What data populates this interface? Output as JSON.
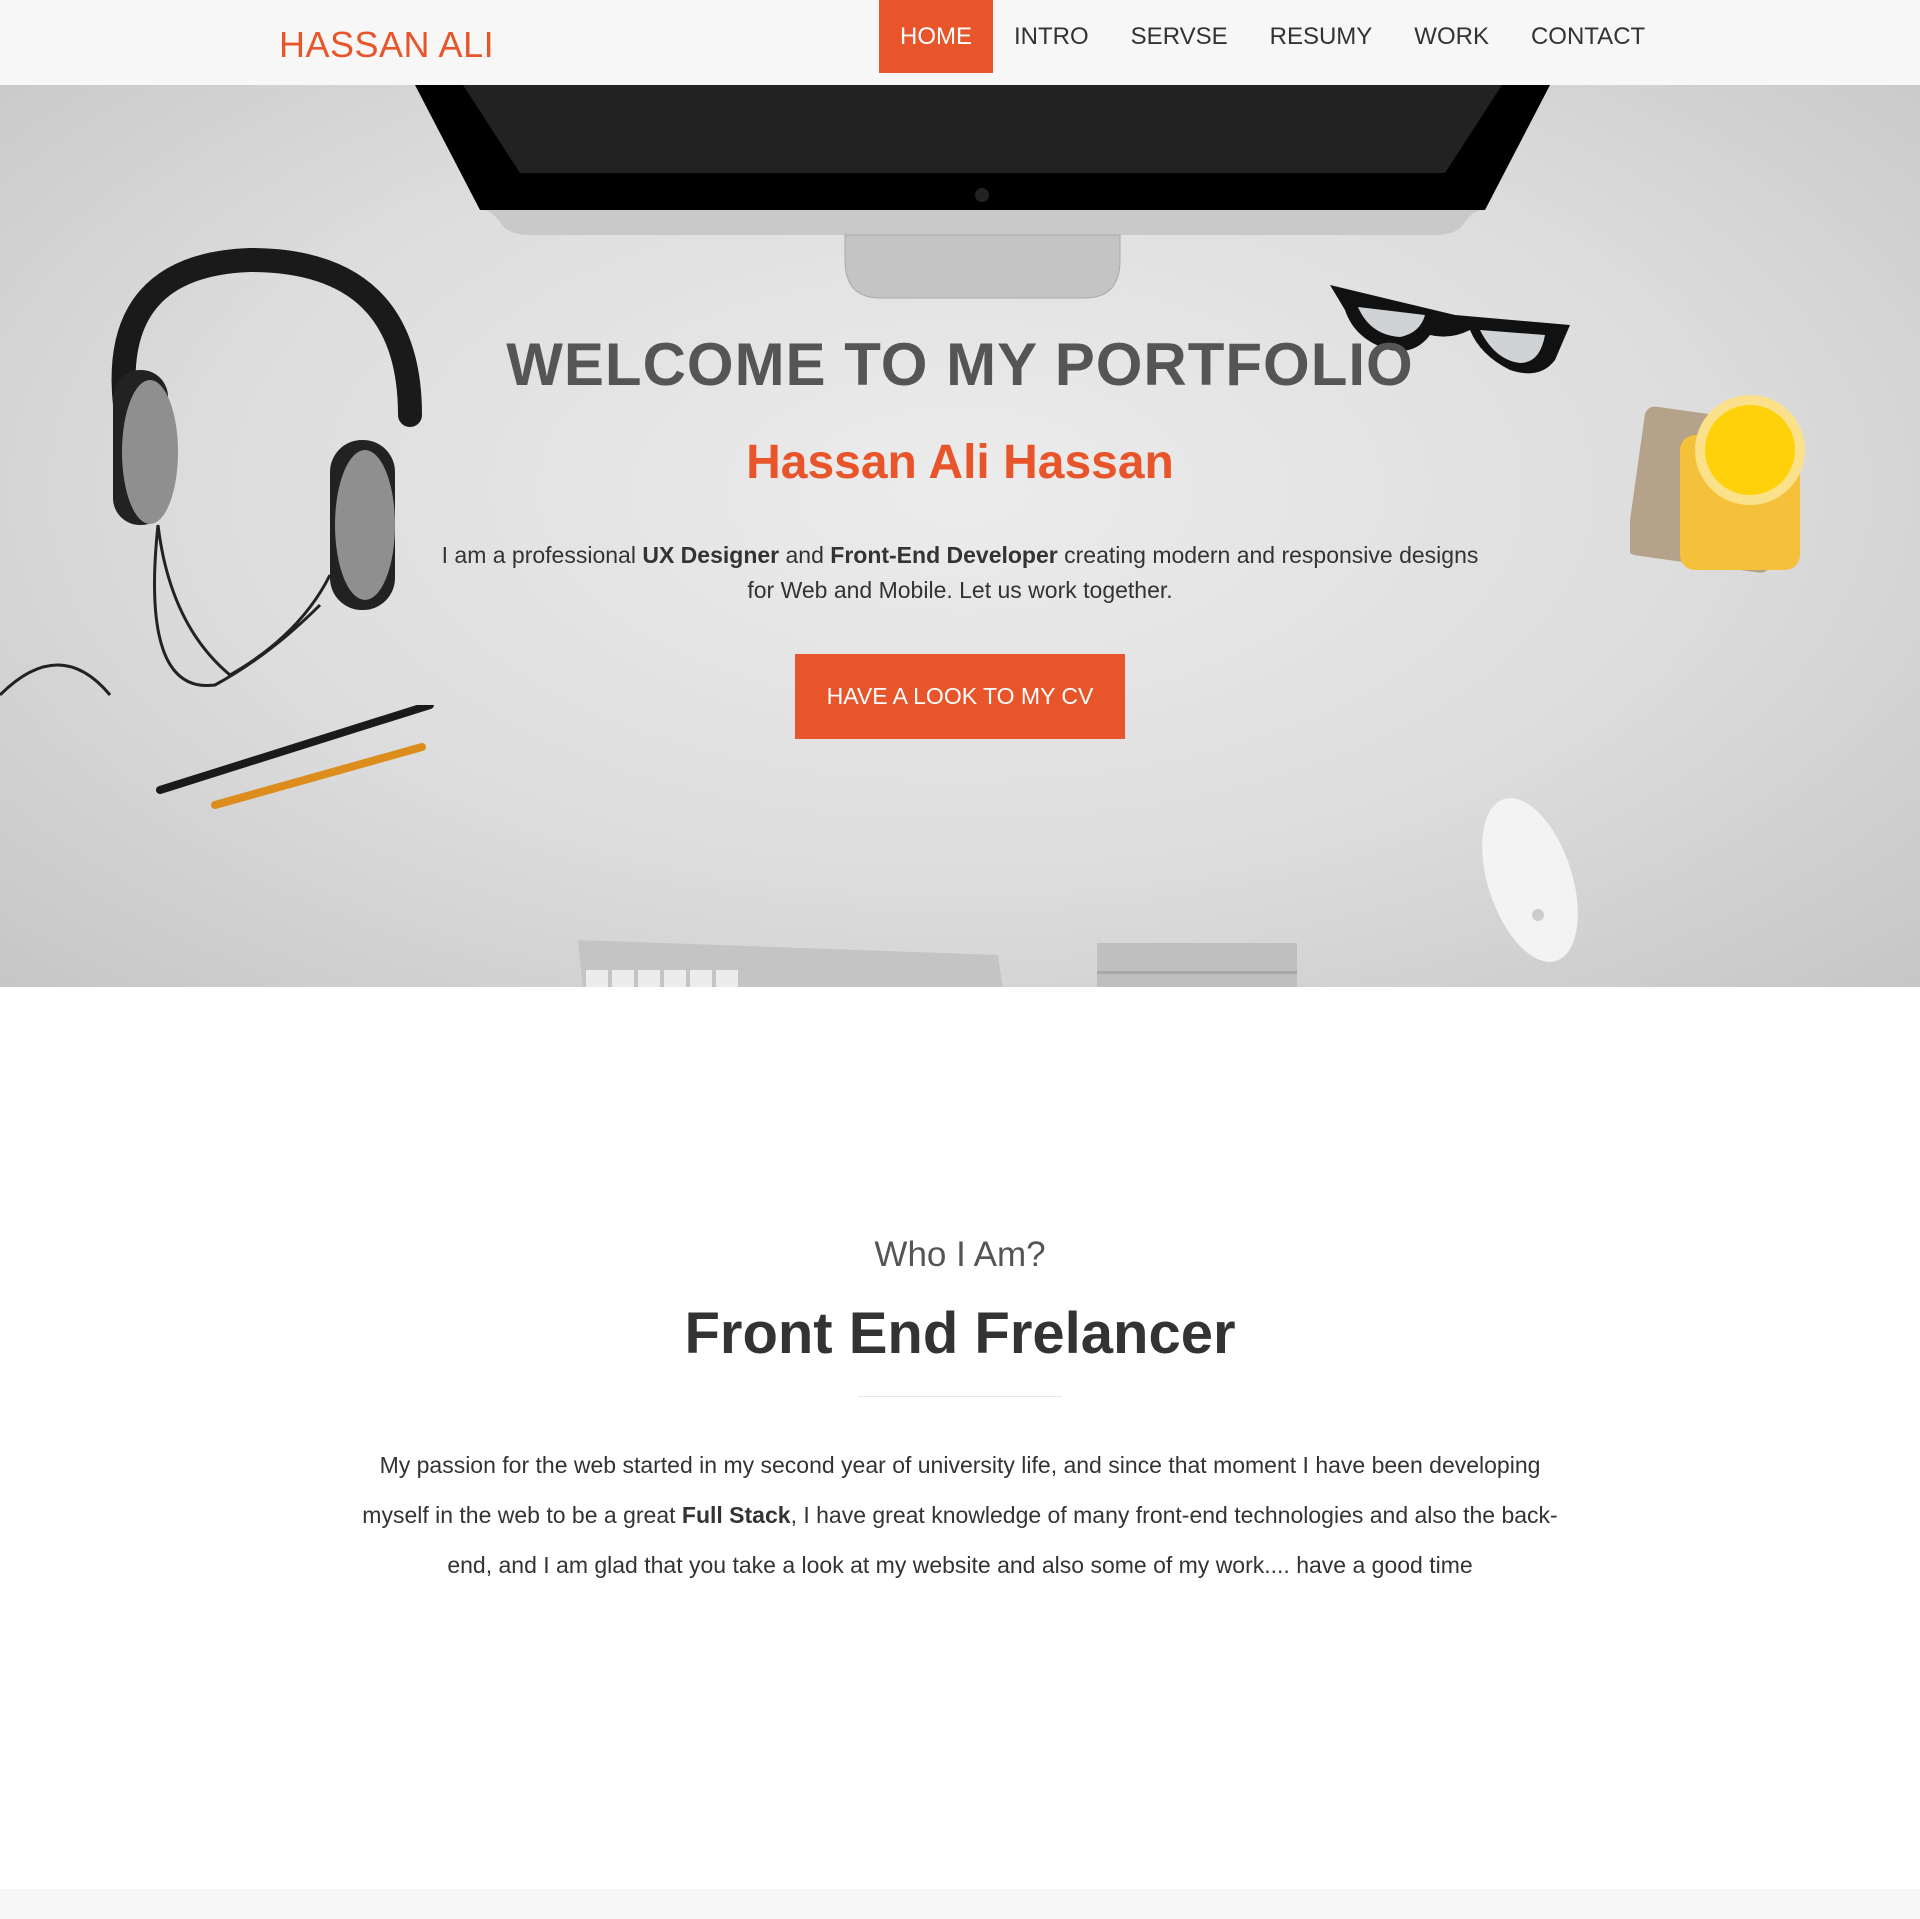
{
  "brand": "HASSAN ALI",
  "nav": [
    "HOME",
    "INTRO",
    "SERVSE",
    "RESUMY",
    "WORK",
    "CONTACT"
  ],
  "nav_active": "HOME",
  "accent_color": "#e8552a",
  "hero": {
    "title": "WELCOME TO MY PORTFOLIO",
    "subtitle": "Hassan Ali Hassan",
    "desc_1": "I am a professional ",
    "desc_bold_1": "UX Designer",
    "desc_2": " and ",
    "desc_bold_2": "Front-End Developer",
    "desc_3": " creating modern and responsive designs for Web and Mobile. Let us work together.",
    "cta": "HAVE A LOOK TO MY CV",
    "decor_icons": [
      "imac-icon",
      "headphones-icon",
      "glasses-icon",
      "juice-glass-icon",
      "pencils-icon",
      "keyboard-icon",
      "trackpad-icon",
      "mouse-icon"
    ]
  },
  "about": {
    "kicker": "Who I Am?",
    "title": "Front End Frelancer",
    "text_1": "My passion for the web started in my second year of university life, and since that moment I have been developing myself in the web to be a great ",
    "text_bold": "Full Stack",
    "text_2": ", I have great knowledge of many front-end technologies and also the back-end, and I am glad that you take a look at my website and also some of my work.... have a good time"
  }
}
